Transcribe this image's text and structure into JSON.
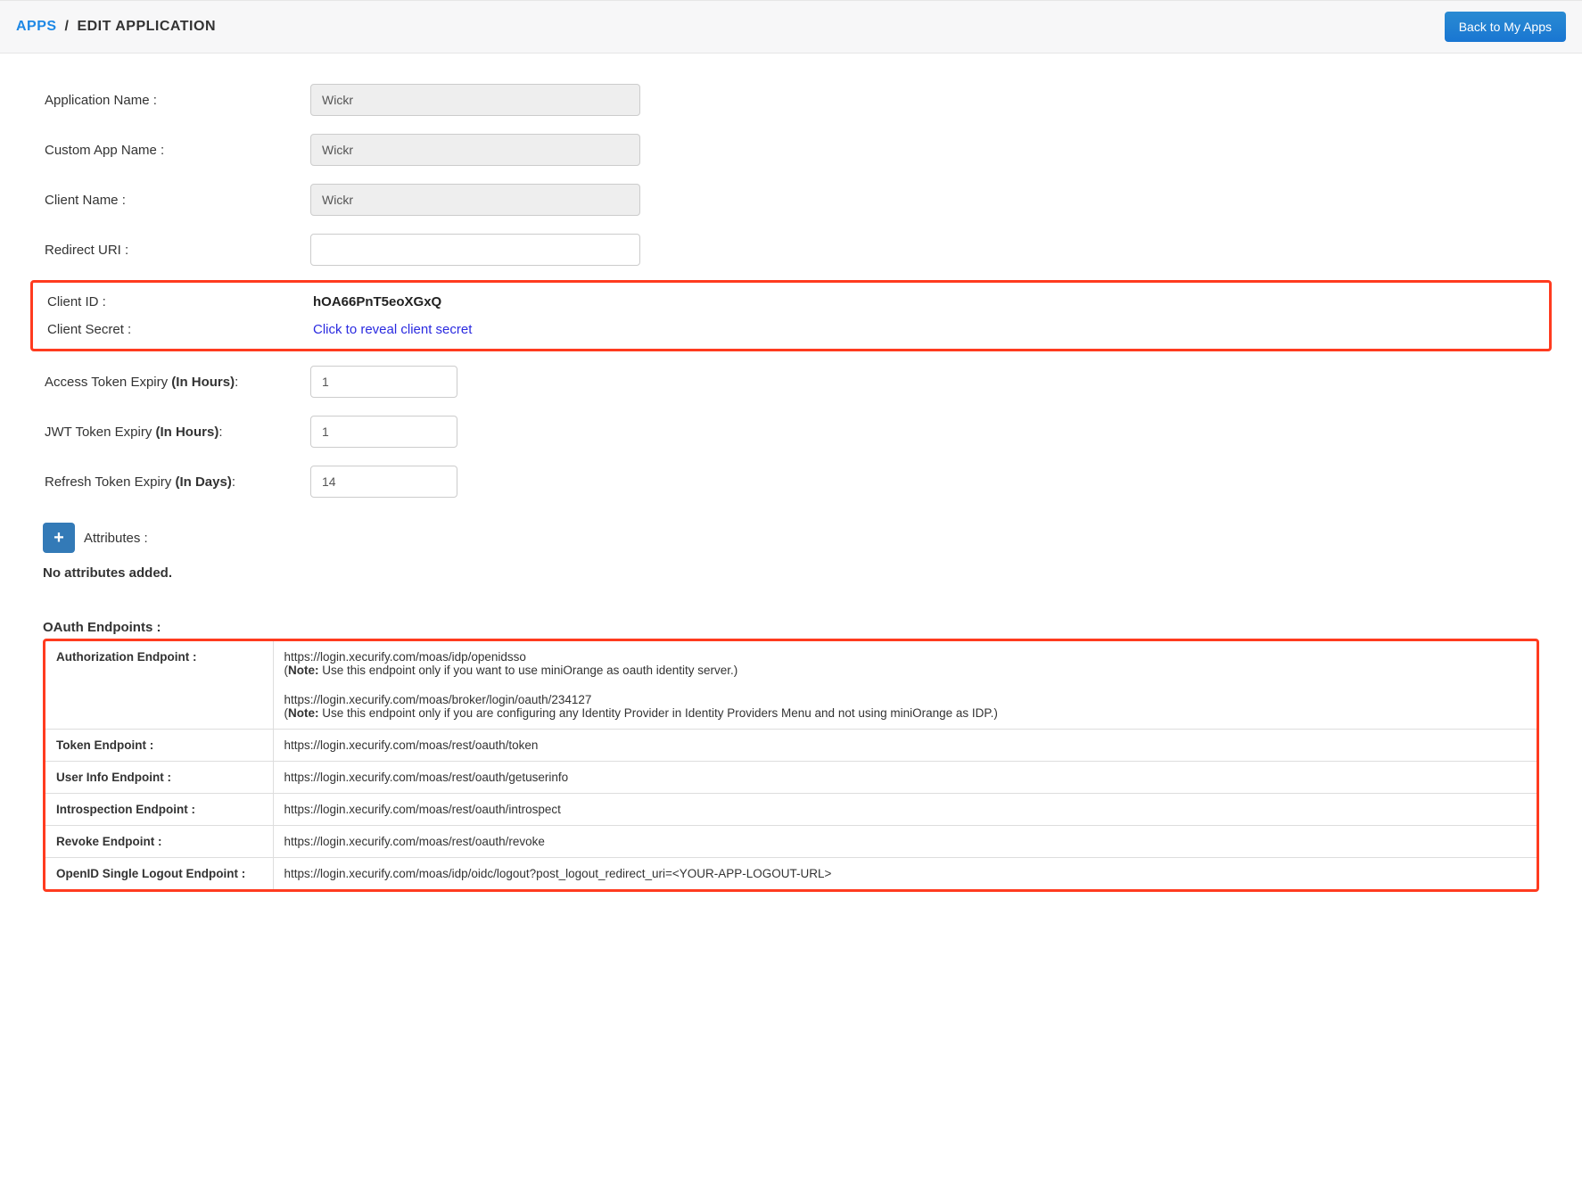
{
  "header": {
    "breadcrumb_link": "APPS",
    "breadcrumb_separator": "/",
    "breadcrumb_current": "EDIT APPLICATION",
    "back_button": "Back to My Apps"
  },
  "form": {
    "application_name": {
      "label": "Application Name :",
      "value": "Wickr"
    },
    "custom_app_name": {
      "label": "Custom App Name :",
      "value": "Wickr"
    },
    "client_name": {
      "label": "Client Name :",
      "value": "Wickr"
    },
    "redirect_uri": {
      "label": "Redirect URI :",
      "value": ""
    },
    "client_id": {
      "label": "Client ID :",
      "value": "hOA66PnT5eoXGxQ"
    },
    "client_secret": {
      "label": "Client Secret :",
      "link_text": "Click to reveal client secret"
    },
    "access_token_expiry": {
      "label_prefix": "Access Token Expiry ",
      "label_suffix": "(In Hours)",
      "colon": ":",
      "value": "1"
    },
    "jwt_token_expiry": {
      "label_prefix": "JWT Token Expiry ",
      "label_suffix": "(In Hours)",
      "colon": ":",
      "value": "1"
    },
    "refresh_token_expiry": {
      "label_prefix": "Refresh Token Expiry ",
      "label_suffix": "(In Days)",
      "colon": ":",
      "value": "14"
    }
  },
  "attributes": {
    "add_icon": "+",
    "label": "Attributes :",
    "no_attributes": "No attributes added."
  },
  "endpoints": {
    "title": "OAuth Endpoints :",
    "rows": {
      "authorization": {
        "label": "Authorization Endpoint :",
        "url1": "https://login.xecurify.com/moas/idp/openidsso",
        "note1_prefix": "(",
        "note1_label": "Note:",
        "note1_text": " Use this endpoint only if you want to use miniOrange as oauth identity server.)",
        "url2": "https://login.xecurify.com/moas/broker/login/oauth/234127",
        "note2_prefix": "(",
        "note2_label": "Note:",
        "note2_text": " Use this endpoint only if you are configuring any Identity Provider in Identity Providers Menu and not using miniOrange as IDP.)"
      },
      "token": {
        "label": "Token Endpoint :",
        "url": "https://login.xecurify.com/moas/rest/oauth/token"
      },
      "userinfo": {
        "label": "User Info Endpoint :",
        "url": "https://login.xecurify.com/moas/rest/oauth/getuserinfo"
      },
      "introspection": {
        "label": "Introspection Endpoint :",
        "url": "https://login.xecurify.com/moas/rest/oauth/introspect"
      },
      "revoke": {
        "label": "Revoke Endpoint :",
        "url": "https://login.xecurify.com/moas/rest/oauth/revoke"
      },
      "logout": {
        "label": "OpenID Single Logout Endpoint :",
        "url": "https://login.xecurify.com/moas/idp/oidc/logout?post_logout_redirect_uri=<YOUR-APP-LOGOUT-URL>"
      }
    }
  }
}
